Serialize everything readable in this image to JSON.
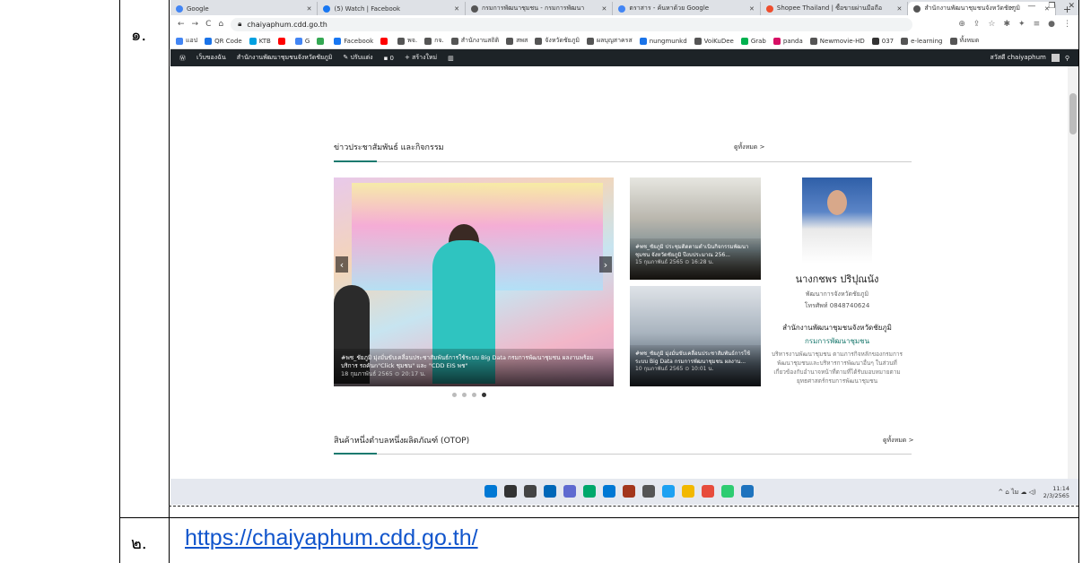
{
  "document": {
    "row1_number": "๑.",
    "row2_number": "๒.",
    "url_text": "https://chaiyaphum.cdd.go.th/"
  },
  "browser": {
    "tabs": [
      {
        "label": "Google",
        "color": "#4285f4"
      },
      {
        "label": "(5) Watch | Facebook",
        "color": "#1877f2"
      },
      {
        "label": "กรมการพัฒนาชุมชน - กรมการพัฒนา",
        "color": "#555555"
      },
      {
        "label": "ตราสาร - ค้นหาด้วย Google",
        "color": "#4285f4"
      },
      {
        "label": "Shopee Thailand | ซื้อขายผ่านมือถือ",
        "color": "#ee4d2d"
      },
      {
        "label": "สำนักงานพัฒนาชุมชนจังหวัดชัยภูมิ",
        "color": "#555555",
        "active": true
      }
    ],
    "new_tab": "+",
    "address": "chaiyaphum.cdd.go.th",
    "bookmarks": [
      {
        "label": "แอป",
        "color": "#4285f4"
      },
      {
        "label": "QR Code",
        "color": "#1a73e8"
      },
      {
        "label": "KTB",
        "color": "#00a0e0"
      },
      {
        "label": "",
        "color": "#ff0000"
      },
      {
        "label": "G",
        "color": "#4285f4"
      },
      {
        "label": "",
        "color": "#34a853"
      },
      {
        "label": "Facebook",
        "color": "#1877f2"
      },
      {
        "label": "",
        "color": "#ff0000"
      },
      {
        "label": "พจ.",
        "color": "#555555"
      },
      {
        "label": "กจ.",
        "color": "#555555"
      },
      {
        "label": "สำนักงานสถิติ",
        "color": "#555555"
      },
      {
        "label": "สพส",
        "color": "#555555"
      },
      {
        "label": "จังหวัดชัยภูมิ",
        "color": "#555555"
      },
      {
        "label": "ผลบุญสาครส",
        "color": "#555555"
      },
      {
        "label": "nungmunkd",
        "color": "#1a73e8"
      },
      {
        "label": "VoiKuDee",
        "color": "#555555"
      },
      {
        "label": "Grab",
        "color": "#00b14f"
      },
      {
        "label": "panda",
        "color": "#d70f64"
      },
      {
        "label": "Newmovie-HD",
        "color": "#555555"
      },
      {
        "label": "037",
        "color": "#333333"
      },
      {
        "label": "e-learning",
        "color": "#555555"
      },
      {
        "label": "ทั้งหมด",
        "color": "#555555"
      }
    ]
  },
  "wp_admin": {
    "site_short": "เว็บของฉัน",
    "site_name": "สำนักงานพัฒนาชุมชนจังหวัดชัยภูมิ",
    "customize": "ปรับแต่ง",
    "comments": "0",
    "new_item": "สร้างใหม่",
    "greeting": "สวัสดี chaiyaphum"
  },
  "news": {
    "title": "ข่าวประชาสัมพันธ์ และกิจกรรม",
    "see_all": "ดูทั้งหมด >",
    "slide_caption": "#พช_ชัยภูมิ มุ่งมั่นขับเคลื่อนประชาสัมพันธ์การใช้ระบบ Big Data กรมการพัฒนาชุมชน ผลงานพร้อมบริการ รถคันn\"Click ชุมชน\" และ \"CDD EIS พช\"",
    "slide_date": "18 กุมภาพันธ์ 2565 ⊙ 20:17 น.",
    "cards": [
      {
        "caption": "#พช_ชัยภูมิ ประชุมติดตามดำเนินกิจกรรมพัฒนาชุมชน จังหวัดชัยภูมิ ปีงบประมาณ 256...",
        "date": "15 กุมภาพันธ์ 2565 ⊙ 16:28 น."
      },
      {
        "caption": "#พช_ชัยภูมิ มุ่งมั่นขับเคลื่อนประชาสัมพันธ์การใช้ระบบ Big Data กรมการพัฒนาชุมชน ผลงาน...",
        "date": "10 กุมภาพันธ์ 2565 ⊙ 10:01 น."
      }
    ],
    "dots": [
      false,
      false,
      false,
      true
    ]
  },
  "profile": {
    "name": "นางกชพร ปริปุณนัง",
    "position": "พัฒนาการจังหวัดชัยภูมิ",
    "phone": "โทรศัพท์ 0848740624",
    "org": "สำนักงานพัฒนาชุมชนจังหวัดชัยภูมิ",
    "dept": "กรมการพัฒนาชุมชน",
    "desc": "บริหารงานพัฒนาชุมชน ตามภารกิจหลักของกรมการพัฒนาชุมชนและบริหารการพัฒนาอื่นๆ ในส่วนที่เกี่ยวข้องกับอำนาจหน้าที่ตามที่ได้รับมอบหมายตามยุทธศาสตร์กรมการพัฒนาชุมชน"
  },
  "otop": {
    "title": "สินค้าหนึ่งตำบลหนึ่งผลิตภัณฑ์ (OTOP)",
    "see_all": "ดูทั้งหมด >"
  },
  "taskbar": {
    "icons": [
      "#0078d4",
      "#333333",
      "#444444",
      "#0067b8",
      "#5f6ad0",
      "#00a86b",
      "#0078d4",
      "#a3361c",
      "#555555",
      "#1da1f2",
      "#f2b800",
      "#e74c3c",
      "#2ecc71",
      "#1e73be"
    ],
    "tray": "^ ⌂ ไม ☁ ◁)",
    "time": "11:14",
    "date": "2/3/2565"
  },
  "colors": {
    "accent": "#1c7a6f",
    "wp_bar": "#1d2327"
  }
}
